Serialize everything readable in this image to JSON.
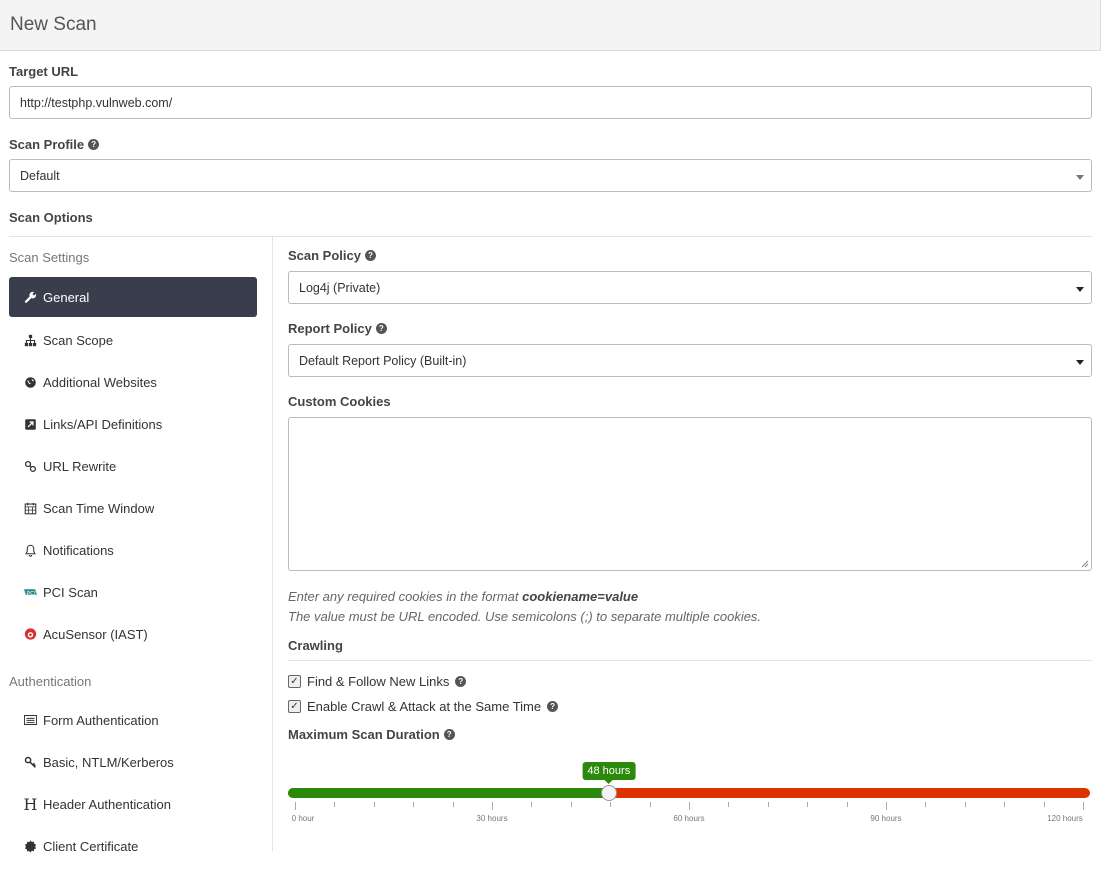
{
  "header": {
    "title": "New Scan"
  },
  "target_url": {
    "label": "Target URL",
    "value": "http://testphp.vulnweb.com/"
  },
  "scan_profile": {
    "label": "Scan Profile",
    "value": "Default"
  },
  "scan_options": {
    "label": "Scan Options"
  },
  "sidebar": {
    "scan_settings_heading": "Scan Settings",
    "settings_items": [
      {
        "label": "General",
        "icon": "wrench-icon"
      },
      {
        "label": "Scan Scope",
        "icon": "sitemap-icon"
      },
      {
        "label": "Additional Websites",
        "icon": "globe-icon"
      },
      {
        "label": "Links/API Definitions",
        "icon": "external-link-icon"
      },
      {
        "label": "URL Rewrite",
        "icon": "link-icon"
      },
      {
        "label": "Scan Time Window",
        "icon": "calendar-icon"
      },
      {
        "label": "Notifications",
        "icon": "bell-icon"
      },
      {
        "label": "PCI Scan",
        "icon": "pci-icon"
      },
      {
        "label": "AcuSensor (IAST)",
        "icon": "acusensor-icon"
      }
    ],
    "auth_heading": "Authentication",
    "auth_items": [
      {
        "label": "Form Authentication",
        "icon": "form-icon"
      },
      {
        "label": "Basic, NTLM/Kerberos",
        "icon": "key-icon"
      },
      {
        "label": "Header Authentication",
        "icon": "header-icon"
      },
      {
        "label": "Client Certificate",
        "icon": "certificate-icon"
      }
    ]
  },
  "main": {
    "scan_policy": {
      "label": "Scan Policy",
      "value": "Log4j (Private)"
    },
    "report_policy": {
      "label": "Report Policy",
      "value": "Default Report Policy (Built-in)"
    },
    "custom_cookies": {
      "label": "Custom Cookies",
      "value": "",
      "help_prefix": "Enter any required cookies in the format ",
      "help_bold": "cookiename=value",
      "help_line2": "The value must be URL encoded. Use semicolons (;) to separate multiple cookies."
    },
    "crawling": {
      "label": "Crawling",
      "options": [
        {
          "label": "Find & Follow New Links",
          "checked": true
        },
        {
          "label": "Enable Crawl & Attack at the Same Time",
          "checked": true
        }
      ]
    },
    "max_duration": {
      "label": "Maximum Scan Duration",
      "value_label": "48 hours",
      "value": 48,
      "min": 0,
      "max": 120,
      "tick_labels": [
        "0 hour",
        "30 hours",
        "60 hours",
        "90 hours",
        "120 hours"
      ],
      "low_color": "#2b8a0c",
      "high_color": "#dd3300"
    }
  }
}
